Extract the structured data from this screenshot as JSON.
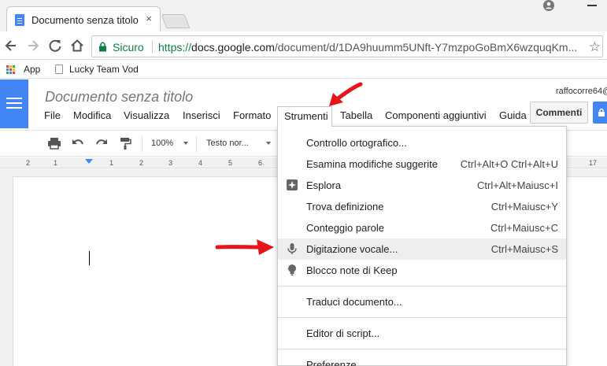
{
  "browser": {
    "tab_title": "Documento senza titolo",
    "tab_close": "×",
    "secure_label": "Sicuro",
    "url_scheme": "https://",
    "url_host": "docs.google.com",
    "url_path": "/document/d/1DA9huumm5UNft-Y7mzpoGoBmX6wzquqKm...",
    "star": "☆"
  },
  "bookmarks": {
    "apps_label": "App",
    "lucky_label": "Lucky Team Vod"
  },
  "docs": {
    "title": "Documento senza titolo",
    "user_email": "raffocorre64@",
    "comments_label": "Commenti",
    "menu": {
      "file": "File",
      "modifica": "Modifica",
      "visualizza": "Visualizza",
      "inserisci": "Inserisci",
      "formato": "Formato",
      "strumenti": "Strumenti",
      "tabella": "Tabella",
      "componenti": "Componenti aggiuntivi",
      "guida": "Guida"
    },
    "toolbar": {
      "zoom": "100%",
      "style": "Testo nor..."
    },
    "ruler": [
      "2",
      "1",
      "1",
      "2",
      "3",
      "4",
      "5",
      "6",
      "17"
    ]
  },
  "strumenti_menu": {
    "controllo": {
      "label": "Controllo ortografico...",
      "shortcut": ""
    },
    "esamina": {
      "label": "Esamina modifiche suggerite",
      "shortcut": "Ctrl+Alt+O Ctrl+Alt+U"
    },
    "esplora": {
      "label": "Esplora",
      "shortcut": "Ctrl+Alt+Maiusc+I"
    },
    "trova": {
      "label": "Trova definizione",
      "shortcut": "Ctrl+Maiusc+Y"
    },
    "conteggio": {
      "label": "Conteggio parole",
      "shortcut": "Ctrl+Maiusc+C"
    },
    "digitazione": {
      "label": "Digitazione vocale...",
      "shortcut": "Ctrl+Maiusc+S"
    },
    "blocco": {
      "label": "Blocco note di Keep",
      "shortcut": ""
    },
    "traduci": {
      "label": "Traduci documento...",
      "shortcut": ""
    },
    "editor": {
      "label": "Editor di script...",
      "shortcut": ""
    },
    "preferenze": {
      "label": "Preferenze...",
      "shortcut": ""
    }
  },
  "colors": {
    "docs_blue": "#4285f4",
    "secure_green": "#0b8043",
    "arrow_red": "#e8141b"
  }
}
